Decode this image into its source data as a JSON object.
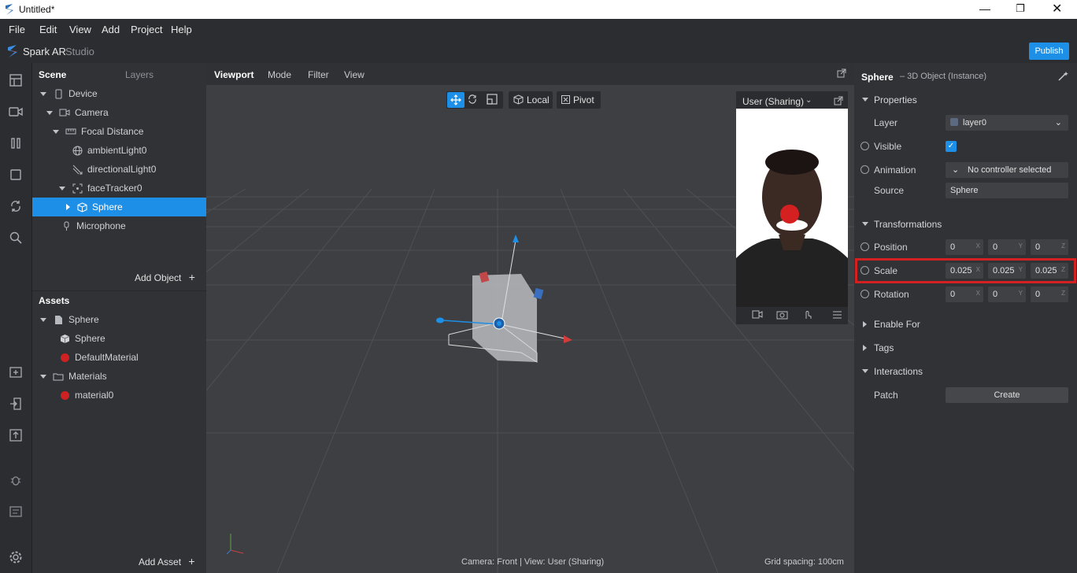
{
  "titlebar": {
    "title": "Untitled*"
  },
  "menu": [
    "File",
    "Edit",
    "View",
    "Add",
    "Project",
    "Help"
  ],
  "brand": {
    "name": "Spark AR",
    "suffix": "Studio",
    "publish": "Publish"
  },
  "scene": {
    "tabs": [
      "Scene",
      "Layers"
    ],
    "tree": [
      "Device",
      "Camera",
      "Focal Distance",
      "ambientLight0",
      "directionalLight0",
      "faceTracker0",
      "Sphere",
      "Microphone"
    ],
    "add_object": "Add Object"
  },
  "assets": {
    "title": "Assets",
    "tree": [
      "Sphere",
      "Sphere",
      "DefaultMaterial",
      "Materials",
      "material0"
    ],
    "add_asset": "Add Asset"
  },
  "viewport": {
    "tabs": [
      "Viewport",
      "Mode",
      "Filter",
      "View"
    ],
    "toolbar": {
      "local": "Local",
      "pivot": "Pivot"
    },
    "preview_title": "User (Sharing)",
    "status_camera": "Camera: Front | View: User (Sharing)",
    "grid_spacing": "Grid spacing: 100cm"
  },
  "inspector": {
    "object_name": "Sphere",
    "object_type": "– 3D Object (Instance)",
    "sections": {
      "properties": "Properties",
      "transformations": "Transformations",
      "enable_for": "Enable For",
      "tags": "Tags",
      "interactions": "Interactions"
    },
    "labels": {
      "layer": "Layer",
      "visible": "Visible",
      "animation": "Animation",
      "source": "Source",
      "position": "Position",
      "scale": "Scale",
      "rotation": "Rotation",
      "patch": "Patch"
    },
    "layer_value": "layer0",
    "animation_value": "No controller selected",
    "source_value": "Sphere",
    "position": [
      "0",
      "0",
      "0"
    ],
    "scale": [
      "0.025",
      "0.025",
      "0.025"
    ],
    "rotation": [
      "0",
      "0",
      "0"
    ],
    "axes": [
      "X",
      "Y",
      "Z"
    ],
    "create": "Create"
  },
  "colors": {
    "accent": "#1e8fe6",
    "highlight": "#d42020"
  }
}
